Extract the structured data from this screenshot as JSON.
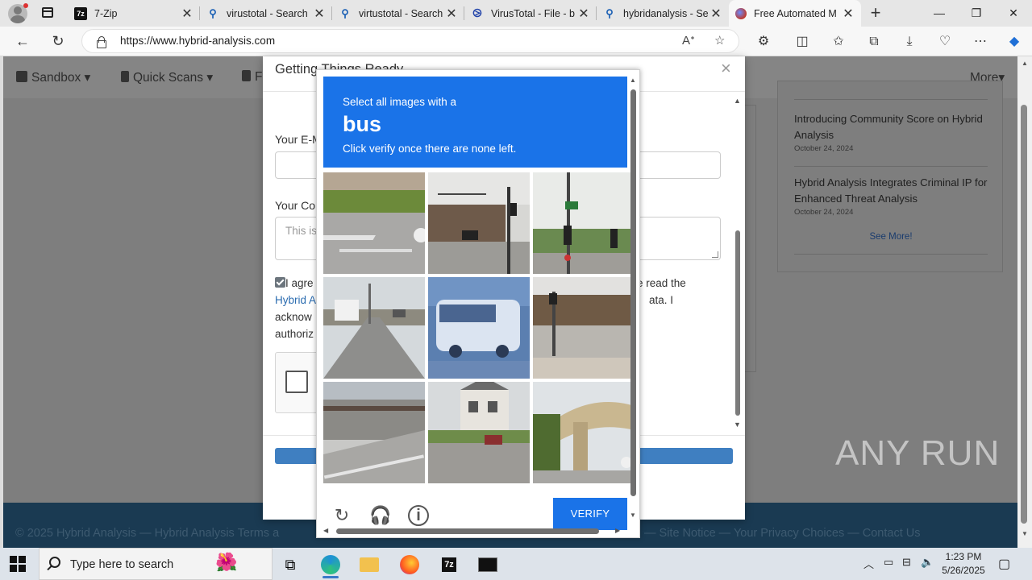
{
  "browser": {
    "tabs": [
      {
        "title": "7-Zip",
        "icon": "7zip-icon"
      },
      {
        "title": "virustotal - Search",
        "icon": "search-icon"
      },
      {
        "title": "virtustotal - Search",
        "icon": "search-icon"
      },
      {
        "title": "VirusTotal - File - b",
        "icon": "virustotal-icon"
      },
      {
        "title": "hybridanalysis - Se",
        "icon": "search-icon"
      },
      {
        "title": "Free Automated M",
        "icon": "hybrid-analysis-icon"
      }
    ],
    "url": "https://www.hybrid-analysis.com"
  },
  "site": {
    "nav": {
      "sandbox": "Sandbox",
      "quick_scans": "Quick Scans",
      "partial": "F",
      "more": "More"
    },
    "news": [
      {
        "title": "Introducing Community Score on Hybrid Analysis",
        "date": "October 24, 2024"
      },
      {
        "title": "Hybrid Analysis Integrates Criminal IP for Enhanced Threat Analysis",
        "date": "October 24, 2024"
      }
    ],
    "see_more": "See More!",
    "footer": "© 2025 Hybrid Analysis — Hybrid Analysis Terms a",
    "footer_right": "— Site Notice — Your Privacy Choices  —   Contact Us"
  },
  "modal": {
    "title": "Getting Things Ready",
    "email_label": "Your E-M",
    "comment_label": "Your Co",
    "comment_placeholder": "This is",
    "agree_line1_left": "I agre",
    "agree_line1_right": "e read the",
    "agree_link": "Hybrid A",
    "agree_line2_right": "ata. I",
    "agree_line3": "acknow",
    "agree_line4": "authoriz"
  },
  "captcha": {
    "instruction": "Select all images with a",
    "target": "bus",
    "sub": "Click verify once there are none left.",
    "verify_label": "VERIFY"
  },
  "watermark": "ANY RUN",
  "taskbar": {
    "search_placeholder": "Type here to search",
    "time": "1:23 PM",
    "date": "5/26/2025"
  }
}
